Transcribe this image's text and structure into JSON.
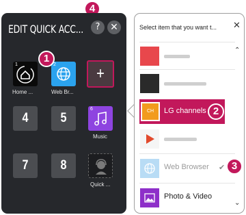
{
  "left_panel": {
    "title": "EDIT QUICK ACC...",
    "help_label": "?",
    "close_label": "✕",
    "tiles": [
      {
        "num": "1",
        "label": "Home ...",
        "icon": "home-icon"
      },
      {
        "num": "2",
        "label": "Web Br...",
        "icon": "globe-icon"
      },
      {
        "label": "+",
        "icon": "add-icon"
      },
      {
        "big": "4"
      },
      {
        "big": "5"
      },
      {
        "num": "6",
        "label": "Music",
        "icon": "music-icon"
      },
      {
        "big": "7"
      },
      {
        "big": "8"
      },
      {
        "label": "Quick ...",
        "icon": "support-icon"
      }
    ]
  },
  "right_panel": {
    "title": "Select item that you want t...",
    "close_label": "✕",
    "items": [
      {
        "label": "",
        "icon": "app-icon"
      },
      {
        "label": "",
        "icon": "app-icon"
      },
      {
        "label": "LG channels",
        "icon": "lg-channels-icon"
      },
      {
        "label": "",
        "icon": "google-play-icon"
      },
      {
        "label": "Web Browser",
        "icon": "globe-icon"
      },
      {
        "label": "Photo & Video",
        "icon": "photo-icon"
      }
    ],
    "check": "✔",
    "up_chevron": "⌃",
    "down_chevron": "⌄"
  },
  "badges": [
    "1",
    "2",
    "3",
    "4"
  ],
  "colors": {
    "accent": "#c2185b",
    "panel_dark": "#26282c",
    "tile": "#4b4d51",
    "web_blue": "#2ba3ee",
    "music_purple": "#8e44e0"
  }
}
